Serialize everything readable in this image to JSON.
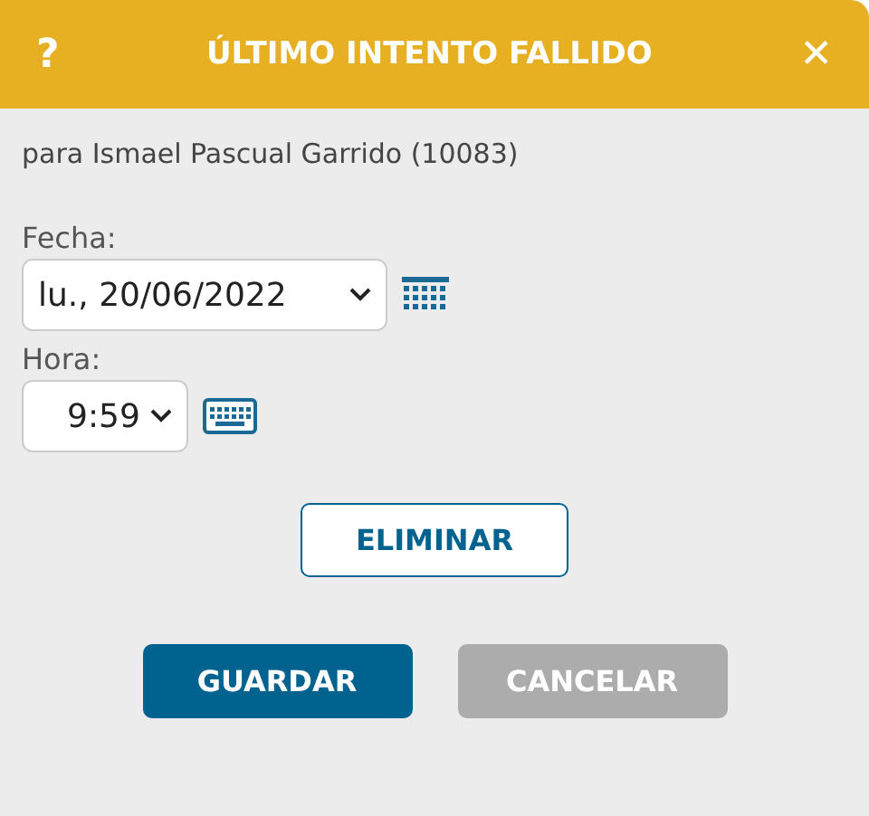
{
  "window": {
    "title": "ÚLTIMO INTENTO FALLIDO",
    "help": "?",
    "close": "✕"
  },
  "subtitle": "para Ismael Pascual Garrido (10083)",
  "fields": [
    {
      "kind": "date",
      "label": "Fecha:",
      "value": "lu., 20/06/2022"
    },
    {
      "kind": "time",
      "label": "Hora:",
      "value": "9:59"
    }
  ],
  "delete_button": "ELIMINAR",
  "buttons": [
    {
      "label": "GUARDAR",
      "kind": "primary"
    },
    {
      "label": "CANCELAR",
      "kind": "secondary"
    }
  ]
}
